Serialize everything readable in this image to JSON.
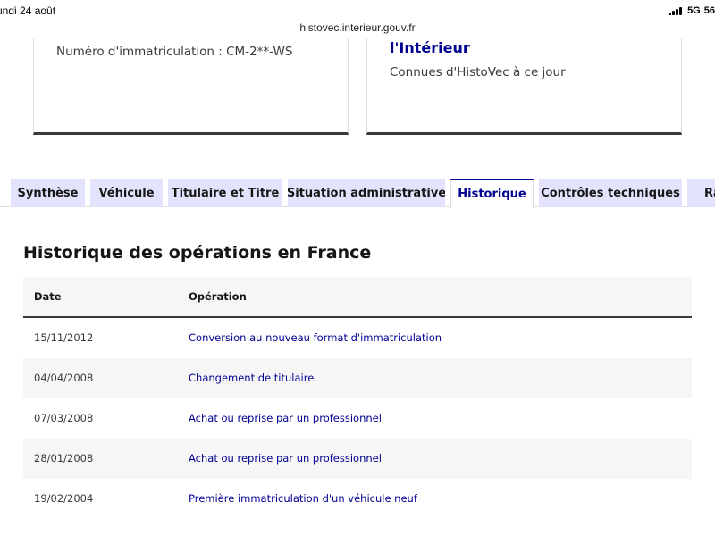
{
  "statusbar": {
    "date": "undi 24 août",
    "network": "5G",
    "extra": "56"
  },
  "browser": {
    "url": "histovec.interieur.gouv.fr"
  },
  "cards": {
    "left_text": "Numéro d'immatriculation : CM-2**-WS",
    "right_title": "l'Intérieur",
    "right_sub": "Connues d'HistoVec à ce jour"
  },
  "tabs": [
    {
      "label": "Synthèse",
      "active": false
    },
    {
      "label": "Véhicule",
      "active": false
    },
    {
      "label": "Titulaire et Titre",
      "active": false
    },
    {
      "label": "Situation administrative",
      "active": false
    },
    {
      "label": "Historique",
      "active": true
    },
    {
      "label": "Contrôles techniques",
      "active": false
    },
    {
      "label": "Ra",
      "active": false
    }
  ],
  "section": {
    "title": "Historique des opérations en France"
  },
  "table": {
    "headers": [
      "Date",
      "Opération"
    ],
    "rows": [
      {
        "date": "15/11/2012",
        "operation": "Conversion au nouveau format d'immatriculation"
      },
      {
        "date": "04/04/2008",
        "operation": "Changement de titulaire"
      },
      {
        "date": "07/03/2008",
        "operation": "Achat ou reprise par un professionnel"
      },
      {
        "date": "28/01/2008",
        "operation": "Achat ou reprise par un professionnel"
      },
      {
        "date": "19/02/2004",
        "operation": "Première immatriculation d'un véhicule neuf"
      }
    ]
  },
  "colors": {
    "accent": "#000091",
    "tab_bg": "#e3e3fd",
    "row_alt": "#f6f6f6"
  }
}
